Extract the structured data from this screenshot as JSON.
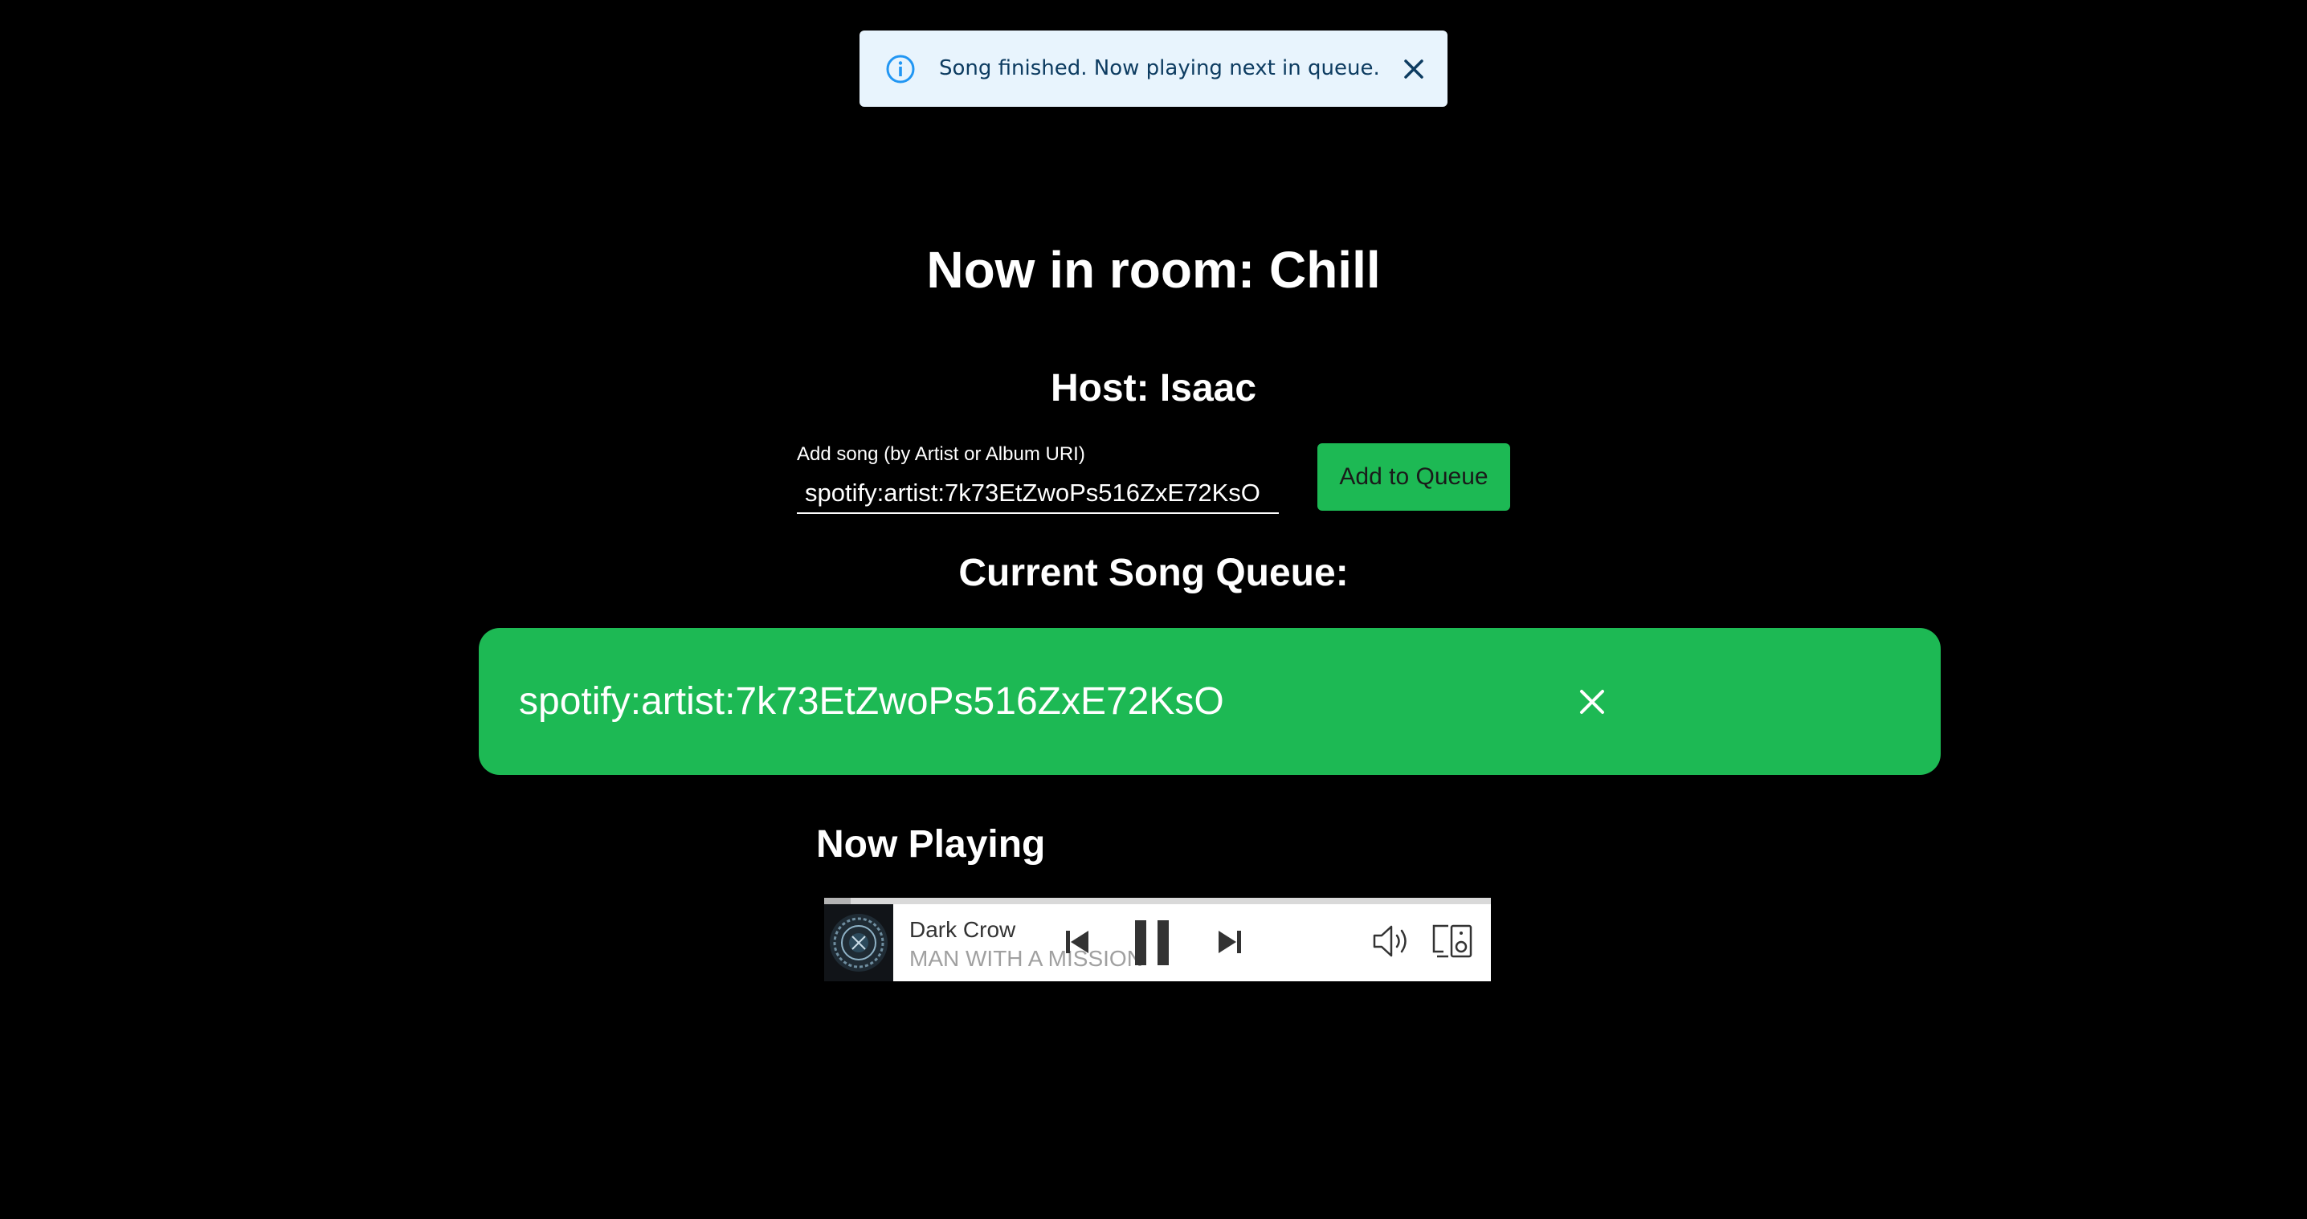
{
  "notification": {
    "message": "Song finished. Now playing next in queue.",
    "severity": "info",
    "icon": "info-icon",
    "close_icon": "close-icon"
  },
  "room": {
    "title": "Now in room: Chill",
    "host": "Host: Isaac"
  },
  "add_song": {
    "label": "Add song (by Artist or Album URI)",
    "value": "spotify:artist:7k73EtZwoPs516ZxE72KsO",
    "button_label": "Add to Queue"
  },
  "queue": {
    "title": "Current Song Queue:",
    "items": [
      {
        "uri": "spotify:artist:7k73EtZwoPs516ZxE72KsO"
      }
    ]
  },
  "now_playing": {
    "title": "Now Playing",
    "track": "Dark Crow",
    "artist": "MAN WITH A MISSION",
    "progress": 0.04,
    "is_playing": true
  },
  "colors": {
    "background": "#000000",
    "accent": "#1db954",
    "toast_bg": "#e8f4fd",
    "toast_text": "#0d3c61",
    "toast_icon": "#2196f3"
  }
}
